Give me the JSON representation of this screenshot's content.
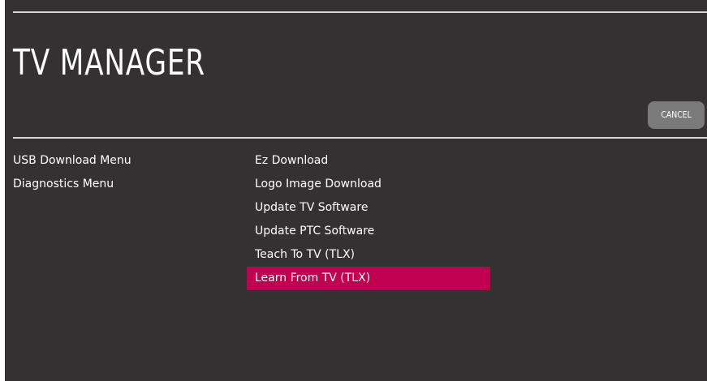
{
  "header": {
    "title": "TV MANAGER",
    "cancel_label": "CANCEL"
  },
  "left_menu": {
    "items": [
      {
        "label": "USB Download Menu"
      },
      {
        "label": "Diagnostics Menu"
      }
    ]
  },
  "right_menu": {
    "selected_index": 5,
    "items": [
      {
        "label": "Ez Download"
      },
      {
        "label": "Logo Image Download"
      },
      {
        "label": "Update TV Software"
      },
      {
        "label": "Update PTC Software"
      },
      {
        "label": "Teach To TV (TLX)"
      },
      {
        "label": "Learn From TV (TLX)"
      }
    ]
  },
  "colors": {
    "background": "#333132",
    "highlight": "#c1004f",
    "button": "#7b7a7b",
    "text": "#ffffff"
  }
}
